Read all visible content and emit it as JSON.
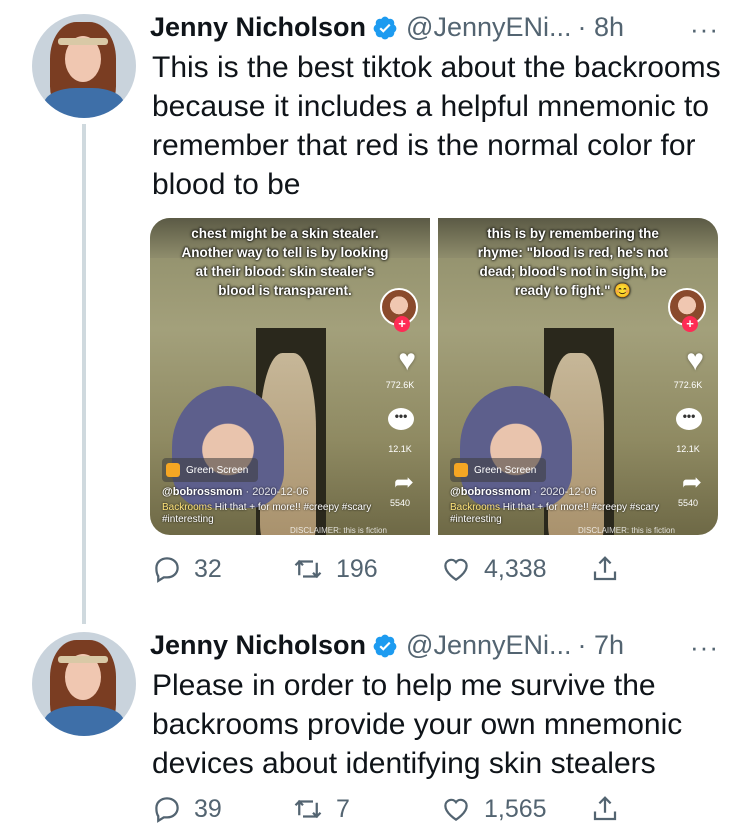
{
  "tweets": [
    {
      "name": "Jenny Nicholson",
      "handle": "@JennyENi...",
      "time": "· 8h",
      "text": "This is the best tiktok about the backrooms because it includes a helpful mnemonic to remember that red is the normal color for blood to be",
      "media": [
        {
          "caption": "chest might be a skin stealer. Another way to tell is by looking at their blood: skin stealer's blood is transparent.",
          "likes": "772.6K",
          "comments": "12.1K",
          "shares": "5540",
          "effect": "Green Screen",
          "username": "@bobrossmom",
          "date": "· 2020-12-06",
          "desc_prefix": "Backrooms",
          "desc_text": " Hit that + for more!! ",
          "hashtags": "#creepy #scary #interesting",
          "disclaimer": "DISCLAIMER: this is fiction"
        },
        {
          "caption": "this is by remembering the rhyme: \"blood is red, he's not dead; blood's not in sight, be ready to fight.\" 😊",
          "likes": "772.6K",
          "comments": "12.1K",
          "shares": "5540",
          "effect": "Green Screen",
          "username": "@bobrossmom",
          "date": "· 2020-12-06",
          "desc_prefix": "Backrooms",
          "desc_text": " Hit that + for more!! ",
          "hashtags": "#creepy #scary #interesting",
          "disclaimer": "DISCLAIMER: this is fiction"
        }
      ],
      "replies": "32",
      "retweets": "196",
      "likes": "4,338"
    },
    {
      "name": "Jenny Nicholson",
      "handle": "@JennyENi...",
      "time": "· 7h",
      "text": "Please in order to help me survive the backrooms provide your own mnemonic devices about identifying skin stealers",
      "replies": "39",
      "retweets": "7",
      "likes": "1,565"
    }
  ],
  "more_symbol": "···",
  "colors": {
    "verified": "#1d9bf0",
    "secondary": "#536471",
    "thread": "#cfd9de"
  },
  "icons": [
    "reply-icon",
    "retweet-icon",
    "like-icon",
    "share-icon",
    "verified-badge-icon",
    "more-icon"
  ]
}
